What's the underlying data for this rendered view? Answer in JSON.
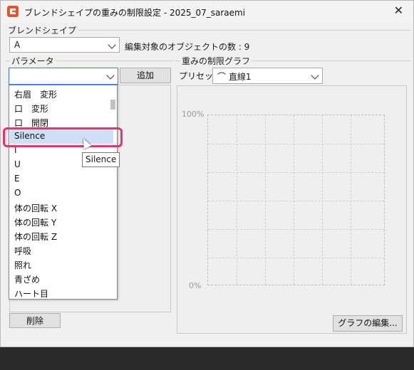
{
  "window": {
    "title": "ブレンドシェイプの重みの制限設定 - 2025_07_saraemi",
    "close": "✕"
  },
  "blendshape": {
    "group_label": "ブレンドシェイプ",
    "selected": "A",
    "info": "編集対象のオブジェクトの数 : 9"
  },
  "params": {
    "group_label": "パラメータ",
    "combo_value": "",
    "add_label": "追加",
    "delete_label": "削除",
    "items": [
      "右眉　変形",
      "口　変形",
      "口　開閉",
      "Silence",
      "I",
      "U",
      "E",
      "O",
      "体の回転 X",
      "体の回転 Y",
      "体の回転 Z",
      "呼吸",
      "照れ",
      "青ざめ",
      "ハート目"
    ],
    "hovered": "Silence",
    "tooltip": "Silence"
  },
  "graph": {
    "group_label": "重みの制限グラフ",
    "preset_label": "プリセット",
    "preset_value": "⌒ 直線1",
    "y_top": "100%",
    "y_bottom": "0%",
    "edit_label": "グラフの編集..."
  },
  "colors": {
    "highlight": "#e8336d",
    "hover": "#cde0f5"
  }
}
